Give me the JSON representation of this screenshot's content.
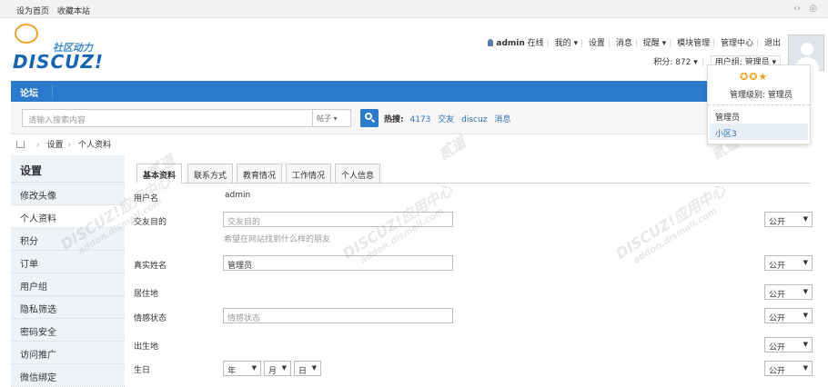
{
  "topbar": {
    "set_home": "设为首页",
    "bookmark": "收藏本站",
    "icons": [
      "code-icon",
      "style-icon"
    ]
  },
  "logo": {
    "zh_text": "社区动力",
    "en_text": "DISCUZ!"
  },
  "usernav": {
    "username": "admin",
    "online": "在线",
    "links": [
      "我的",
      "设置",
      "消息",
      "提醒",
      "模块管理",
      "管理中心",
      "退出"
    ],
    "credits": "积分: 872",
    "group": "用户组: 管理员"
  },
  "navbar": {
    "items": [
      "论坛"
    ]
  },
  "search": {
    "placeholder": "请输入搜索内容",
    "type": "帖子",
    "hot_label": "热搜:",
    "hot_items": [
      "4173",
      "交友",
      "discuz",
      "消息"
    ]
  },
  "breadcrumb": {
    "items": [
      "设置",
      "个人资料"
    ]
  },
  "sidebar": {
    "title": "设置",
    "items": [
      "修改头像",
      "个人资料",
      "积分",
      "订单",
      "用户组",
      "隐私筛选",
      "密码安全",
      "访问推广",
      "微信绑定"
    ],
    "active_index": 1
  },
  "tabs": [
    "基本资料",
    "联系方式",
    "教育情况",
    "工作情况",
    "个人信息"
  ],
  "form": {
    "username_label": "用户名",
    "username_value": "admin",
    "purpose_label": "交友目的",
    "purpose_placeholder": "交友目的",
    "purpose_hint": "希望在网站找到什么样的朋友",
    "realname_label": "真实姓名",
    "realname_value": "管理员",
    "residence_label": "居住地",
    "emotion_label": "情感状态",
    "emotion_placeholder": "情感状态",
    "birthplace_label": "出生地",
    "birthday_label": "生日",
    "year": "年",
    "month": "月",
    "day": "日",
    "privacy_value": "公开"
  },
  "popup": {
    "stars": "✪✪★",
    "level": "管理级别: 管理员",
    "groups": [
      "管理员",
      "小区3"
    ]
  },
  "watermark": {
    "text": "DISCUZ!应用中心",
    "sub": "addon.dismall.com",
    "mark": "贰道"
  }
}
